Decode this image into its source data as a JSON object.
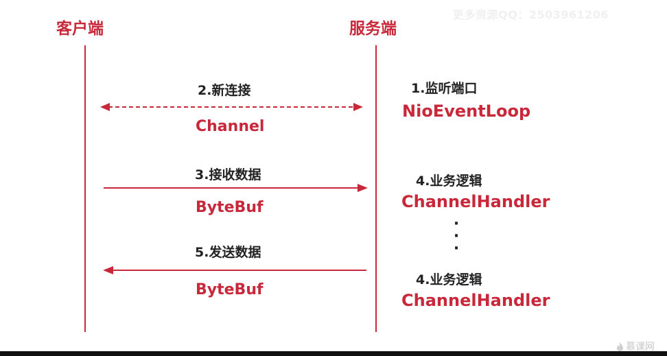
{
  "watermark": "更多资源QQ：2503961206",
  "client": {
    "title": "客户端"
  },
  "server": {
    "title": "服务端"
  },
  "messages": [
    {
      "step": "2.新连接",
      "component": "Channel",
      "direction": "bidirectional",
      "style": "dashed"
    },
    {
      "step": "3.接收数据",
      "component": "ByteBuf",
      "direction": "client-to-server",
      "style": "solid"
    },
    {
      "step": "5.发送数据",
      "component": "ByteBuf",
      "direction": "server-to-client",
      "style": "solid"
    }
  ],
  "server_steps": [
    {
      "step": "1.监听端口",
      "component": "NioEventLoop"
    },
    {
      "step": "4.业务逻辑",
      "component": "ChannelHandler"
    },
    {
      "step": "4.业务逻辑",
      "component": "ChannelHandler"
    }
  ],
  "ellipsis": "⋮",
  "brand": {
    "icon": "flame-icon",
    "text": "慕课网"
  },
  "colors": {
    "accent": "#c8283a",
    "text": "#222222"
  }
}
